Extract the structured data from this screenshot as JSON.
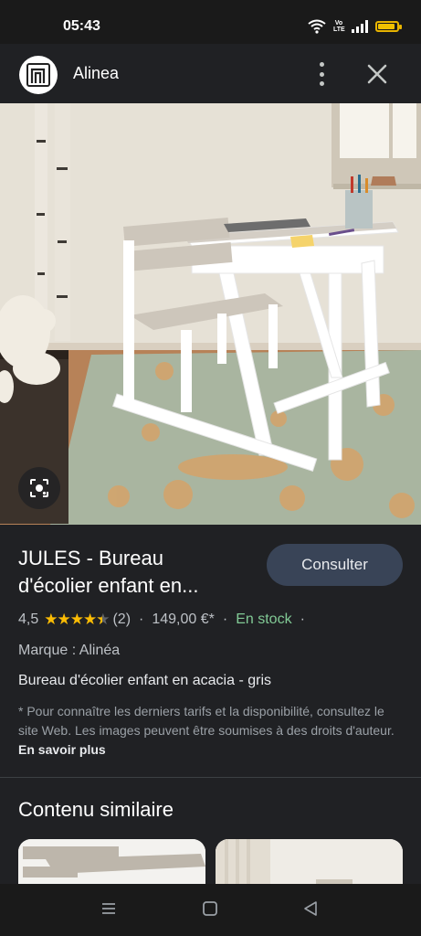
{
  "status_bar": {
    "time": "05:43",
    "icons": [
      "wifi-icon",
      "volte-icon",
      "signal-icon",
      "battery-icon"
    ],
    "lte_text": "Vo LTE",
    "battery_level": 0.9,
    "battery_color": "#f0c000"
  },
  "app_bar": {
    "title": "Alinea",
    "icons": [
      "alinea-logo-icon",
      "more-vert-icon",
      "close-icon"
    ]
  },
  "product": {
    "title_line1": "JULES - Bureau",
    "title_line2": "d'écolier enfant en...",
    "consult_label": "Consulter",
    "rating": "4,5",
    "rating_value": 4.5,
    "reviews": "(2)",
    "price": "149,00 €*",
    "stock": "En stock",
    "brand": "Marque : Alinéa",
    "description": "Bureau d'écolier enfant en acacia - gris",
    "note": "* Pour connaître les derniers tarifs et la disponibilité, consultez le site Web. Les images peuvent être soumises à des droits d'auteur.",
    "learn_more": "En savoir plus"
  },
  "similar": {
    "title": "Contenu similaire"
  },
  "nav": {
    "icons": [
      "recents-icon",
      "home-icon",
      "back-icon"
    ]
  },
  "colors": {
    "background": "#202124",
    "button": "#394457",
    "stock_green": "#81c995",
    "star_yellow": "#fbbc04"
  }
}
